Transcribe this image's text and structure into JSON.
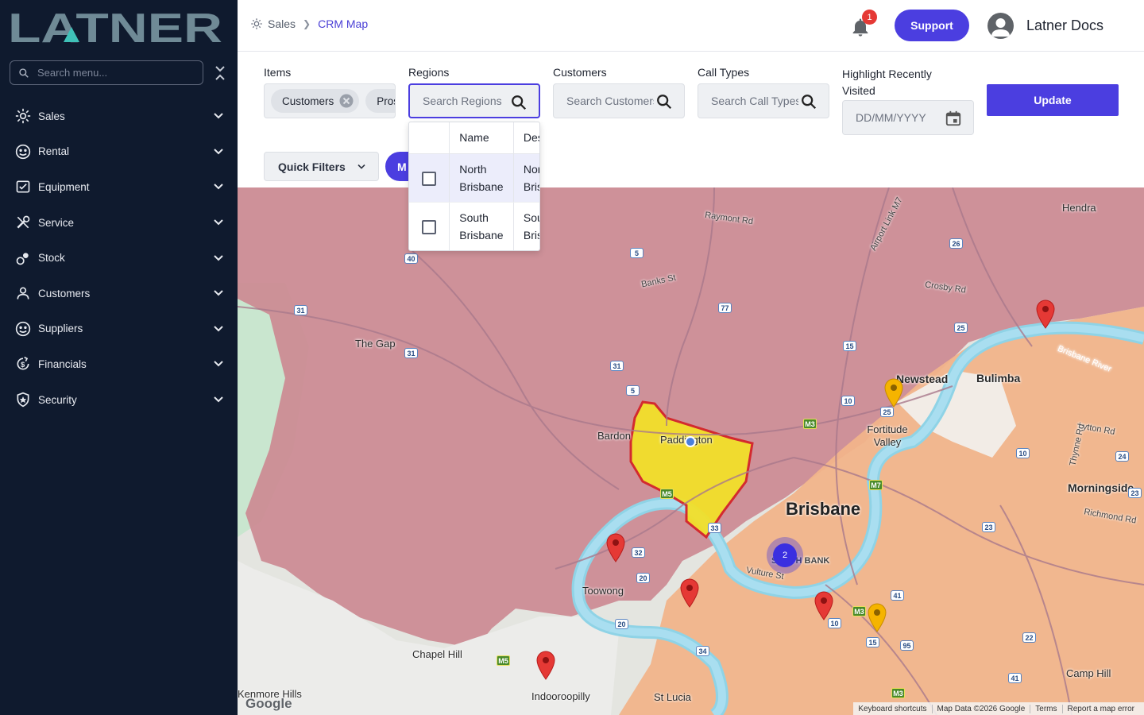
{
  "brand": {
    "name": "LATNER",
    "accent": "#4b3ee0",
    "sidebar_bg": "#0f1a2e"
  },
  "sidebar": {
    "search_placeholder": "Search menu...",
    "items": [
      {
        "label": "Sales",
        "icon": "sales-icon"
      },
      {
        "label": "Rental",
        "icon": "rental-icon"
      },
      {
        "label": "Equipment",
        "icon": "equipment-icon"
      },
      {
        "label": "Service",
        "icon": "service-icon"
      },
      {
        "label": "Stock",
        "icon": "stock-icon"
      },
      {
        "label": "Customers",
        "icon": "person-icon"
      },
      {
        "label": "Suppliers",
        "icon": "suppliers-icon"
      },
      {
        "label": "Financials",
        "icon": "financials-icon"
      },
      {
        "label": "Security",
        "icon": "shield-icon"
      }
    ]
  },
  "header": {
    "breadcrumb": {
      "root": "Sales",
      "current": "CRM Map"
    },
    "notification_count": "1",
    "support_label": "Support",
    "user_name": "Latner Docs"
  },
  "filters": {
    "items": {
      "label": "Items",
      "chips": [
        "Customers",
        "Prospects"
      ]
    },
    "regions": {
      "label": "Regions",
      "placeholder": "Search Regions"
    },
    "customers": {
      "label": "Customers",
      "placeholder": "Search Customers"
    },
    "call_types": {
      "label": "Call Types",
      "placeholder": "Search Call Types"
    },
    "highlight": {
      "label": "Highlight Recently Visited",
      "placeholder": "DD/MM/YYYY"
    },
    "update_label": "Update",
    "quick_filters_label": "Quick Filters",
    "map_button_label": "M"
  },
  "regions_dropdown": {
    "columns": [
      "Name",
      "Description"
    ],
    "rows": [
      {
        "name": "North Brisbane",
        "description": "North Brisbane",
        "checked": false
      },
      {
        "name": "South Brisbane",
        "description": "South Brisbane",
        "checked": false
      }
    ]
  },
  "map": {
    "places": [
      "Hendra",
      "Raymont Rd",
      "Airport Link M7",
      "Banks St",
      "The Gap",
      "Crosby Rd",
      "Brisbane River",
      "Newstead",
      "Bulimba",
      "Fortitude Valley",
      "Bardon",
      "Paddington",
      "Lytton Rd",
      "Thynne Rd",
      "Brisbane",
      "Morningside",
      "Richmond Rd",
      "South Bank",
      "Vulture St",
      "Toowong",
      "Chapel Hill",
      "Indooroopilly",
      "St Lucia",
      "Kenmore Hills",
      "Camp Hill"
    ],
    "cluster_count": "2",
    "attribution": [
      "Keyboard shortcuts",
      "Map Data ©2026 Google",
      "Terms",
      "Report a map error"
    ],
    "google": "Google"
  }
}
